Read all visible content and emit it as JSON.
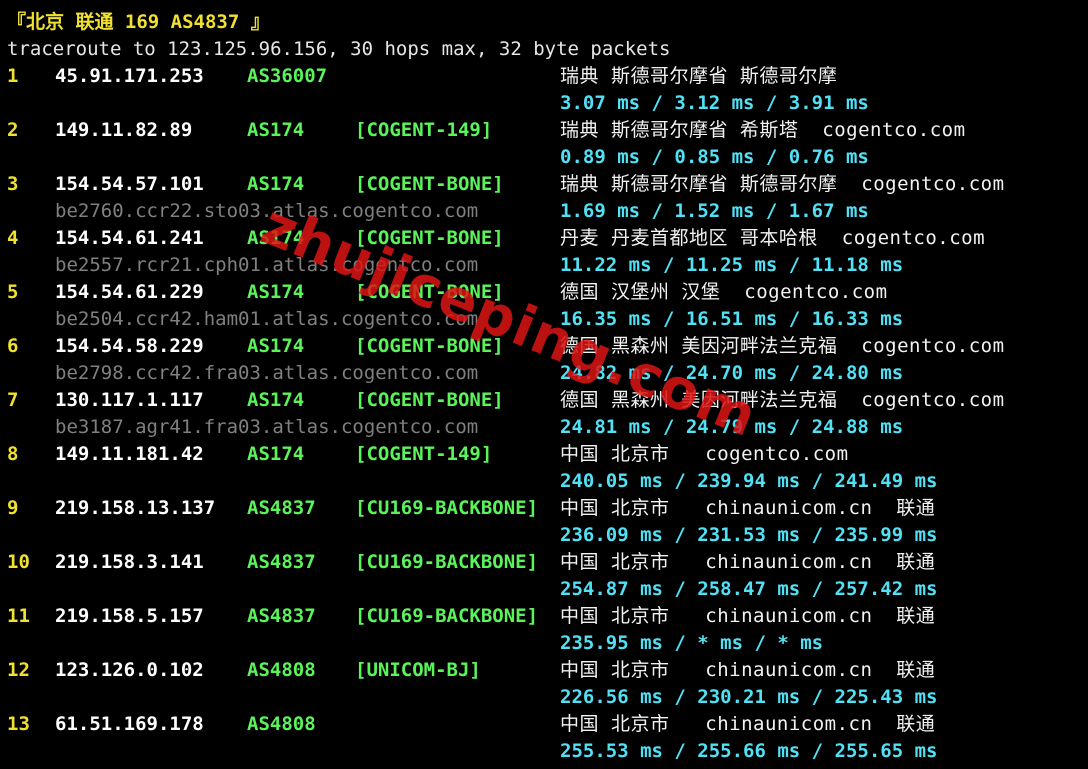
{
  "terminal": {
    "title": "『北京 联通 169 AS4837 』",
    "header": "traceroute to 123.125.96.156, 30 hops max, 32 byte packets",
    "hops": [
      {
        "idx": "1",
        "ip": "45.91.171.253",
        "asn": "AS36007",
        "tag": "",
        "geo": "瑞典 斯德哥尔摩省 斯德哥尔摩",
        "host": "",
        "rtt": "3.07 ms / 3.12 ms / 3.91 ms"
      },
      {
        "idx": "2",
        "ip": "149.11.82.89",
        "asn": "AS174",
        "tag": "[COGENT-149]",
        "geo": "瑞典 斯德哥尔摩省 希斯塔  cogentco.com",
        "host": "",
        "rtt": "0.89 ms / 0.85 ms / 0.76 ms"
      },
      {
        "idx": "3",
        "ip": "154.54.57.101",
        "asn": "AS174",
        "tag": "[COGENT-BONE]",
        "geo": "瑞典 斯德哥尔摩省 斯德哥尔摩  cogentco.com",
        "host": "be2760.ccr22.sto03.atlas.cogentco.com",
        "rtt": "1.69 ms / 1.52 ms / 1.67 ms"
      },
      {
        "idx": "4",
        "ip": "154.54.61.241",
        "asn": "AS174",
        "tag": "[COGENT-BONE]",
        "geo": "丹麦 丹麦首都地区 哥本哈根  cogentco.com",
        "host": "be2557.rcr21.cph01.atlas.cogentco.com",
        "rtt": "11.22 ms / 11.25 ms / 11.18 ms"
      },
      {
        "idx": "5",
        "ip": "154.54.61.229",
        "asn": "AS174",
        "tag": "[COGENT-BONE]",
        "geo": "德国 汉堡州 汉堡  cogentco.com",
        "host": "be2504.ccr42.ham01.atlas.cogentco.com",
        "rtt": "16.35 ms / 16.51 ms / 16.33 ms"
      },
      {
        "idx": "6",
        "ip": "154.54.58.229",
        "asn": "AS174",
        "tag": "[COGENT-BONE]",
        "geo": "德国 黑森州 美因河畔法兰克福  cogentco.com",
        "host": "be2798.ccr42.fra03.atlas.cogentco.com",
        "rtt": "24.82 ms / 24.70 ms / 24.80 ms"
      },
      {
        "idx": "7",
        "ip": "130.117.1.117",
        "asn": "AS174",
        "tag": "[COGENT-BONE]",
        "geo": "德国 黑森州 美因河畔法兰克福  cogentco.com",
        "host": "be3187.agr41.fra03.atlas.cogentco.com",
        "rtt": "24.81 ms / 24.79 ms / 24.88 ms"
      },
      {
        "idx": "8",
        "ip": "149.11.181.42",
        "asn": "AS174",
        "tag": "[COGENT-149]",
        "geo": "中国 北京市   cogentco.com",
        "host": "",
        "rtt": "240.05 ms / 239.94 ms / 241.49 ms"
      },
      {
        "idx": "9",
        "ip": "219.158.13.137",
        "asn": "AS4837",
        "tag": "[CU169-BACKBONE]",
        "geo": "中国 北京市   chinaunicom.cn  联通",
        "host": "",
        "rtt": "236.09 ms / 231.53 ms / 235.99 ms"
      },
      {
        "idx": "10",
        "ip": "219.158.3.141",
        "asn": "AS4837",
        "tag": "[CU169-BACKBONE]",
        "geo": "中国 北京市   chinaunicom.cn  联通",
        "host": "",
        "rtt": "254.87 ms / 258.47 ms / 257.42 ms"
      },
      {
        "idx": "11",
        "ip": "219.158.5.157",
        "asn": "AS4837",
        "tag": "[CU169-BACKBONE]",
        "geo": "中国 北京市   chinaunicom.cn  联通",
        "host": "",
        "rtt": "235.95 ms / * ms / * ms"
      },
      {
        "idx": "12",
        "ip": "123.126.0.102",
        "asn": "AS4808",
        "tag": "[UNICOM-BJ]",
        "geo": "中国 北京市   chinaunicom.cn  联通",
        "host": "",
        "rtt": "226.56 ms / 230.21 ms / 225.43 ms"
      },
      {
        "idx": "13",
        "ip": "61.51.169.178",
        "asn": "AS4808",
        "tag": "",
        "geo": "中国 北京市   chinaunicom.cn  联通",
        "host": "",
        "rtt": "255.53 ms / 255.66 ms / 255.65 ms"
      }
    ]
  },
  "watermark": "zhujiceping.com",
  "colors": {
    "background": "#000000",
    "hop_index": "#f0e130",
    "ip": "#ffffff",
    "asn": "#5af35a",
    "hostname": "#808080",
    "rtt": "#52e0f5",
    "watermark": "#dc1414"
  }
}
